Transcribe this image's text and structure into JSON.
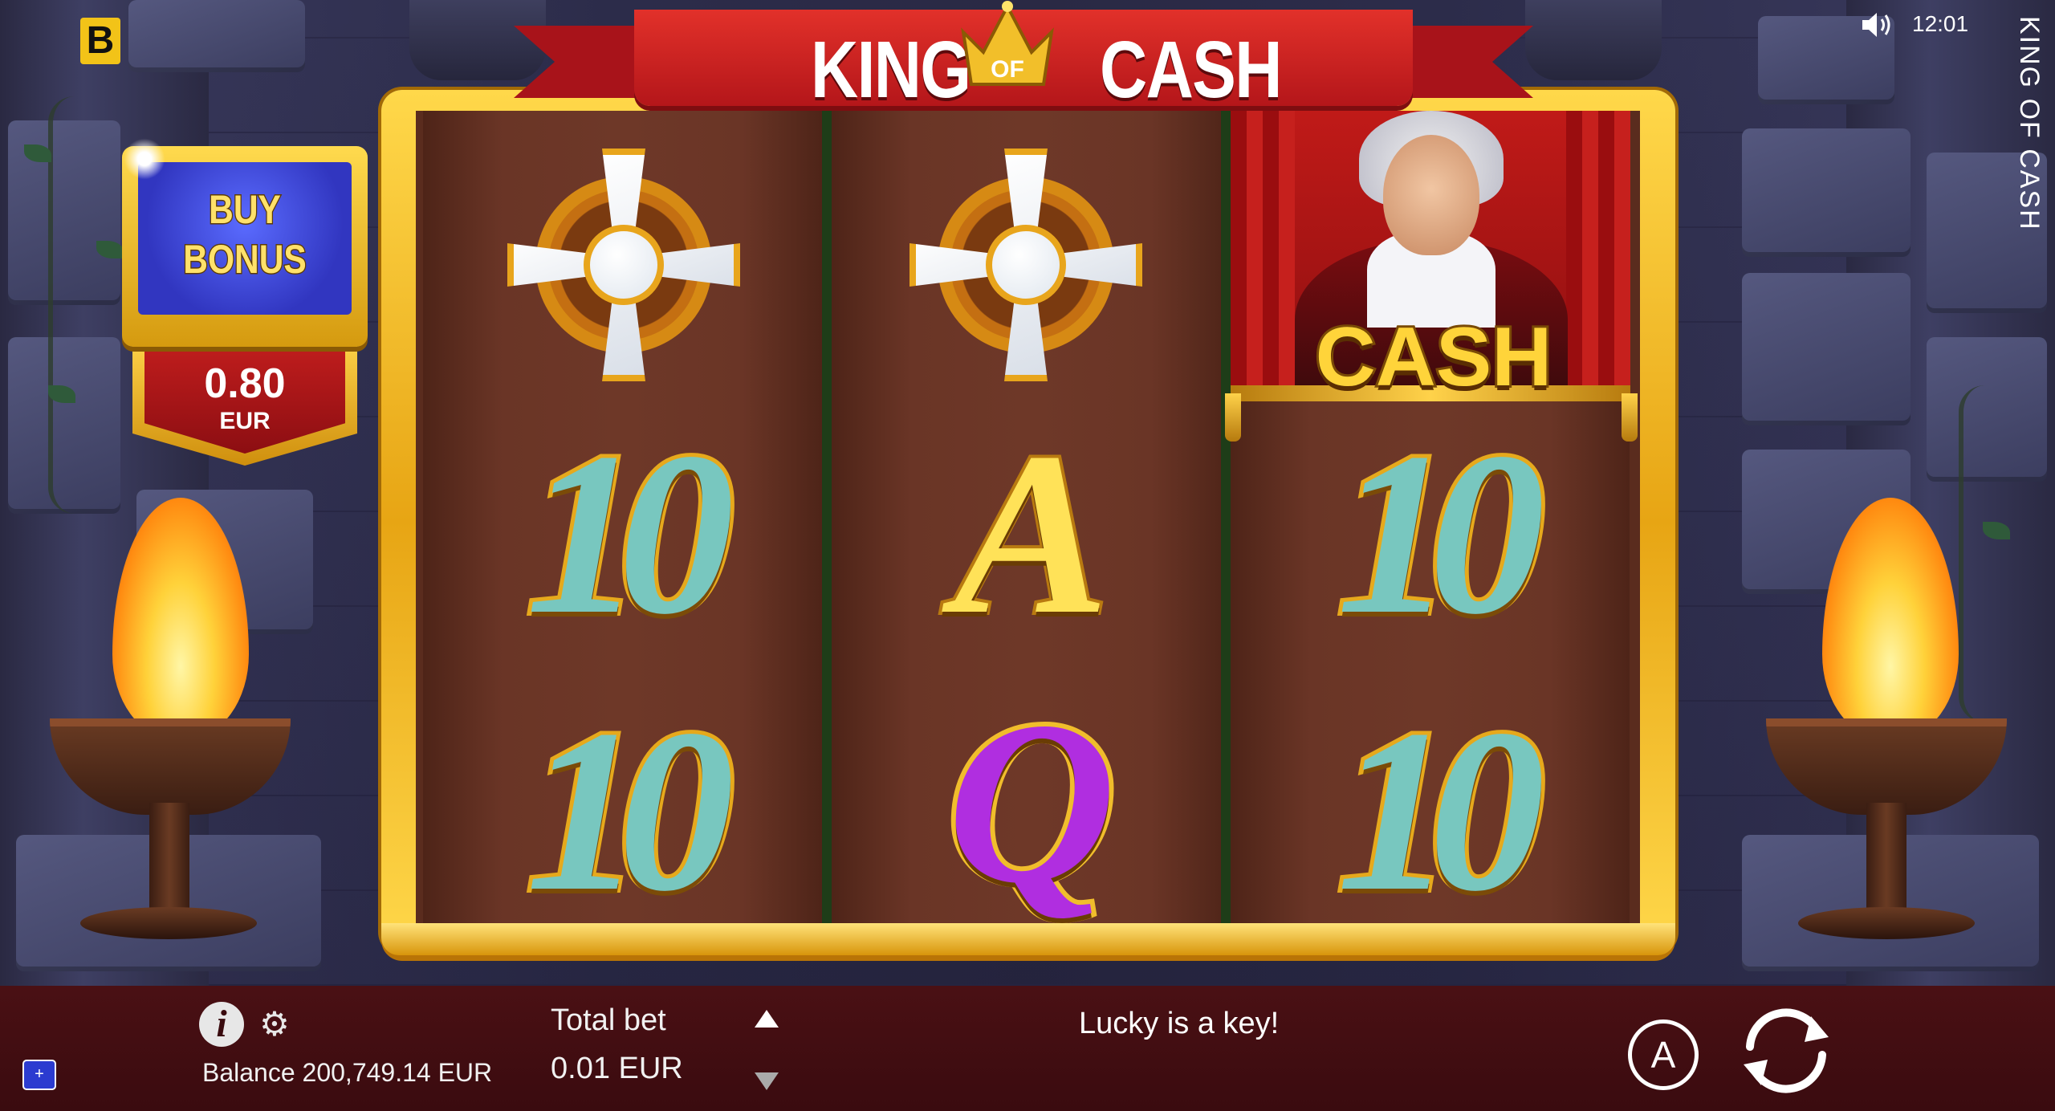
{
  "game": {
    "title_left": "KING",
    "title_of": "OF",
    "title_right": "CASH",
    "vertical_title": "KING OF CASH",
    "logo_letter": "B"
  },
  "status": {
    "time": "12:01"
  },
  "buy_bonus": {
    "label_line1": "BUY",
    "label_line2": "BONUS",
    "price": "0.80",
    "currency": "EUR"
  },
  "reels": [
    {
      "symbols": [
        "order-cross",
        "10",
        "10"
      ]
    },
    {
      "symbols": [
        "order-cross",
        "A",
        "Q"
      ]
    },
    {
      "symbols": [
        "king-cash",
        "10",
        "10"
      ]
    }
  ],
  "cash_symbol_text": "CASH",
  "bottom_bar": {
    "balance": "Balance 200,749.14 EUR",
    "total_bet_label": "Total bet",
    "total_bet_value": "0.01 EUR",
    "message": "Lucky is a key!",
    "auto_label": "A"
  },
  "icons": {
    "sound": "speaker-icon",
    "info": "info-icon",
    "settings": "gear-icon",
    "spin": "spin-icon",
    "autoplay": "autoplay-icon"
  },
  "colors": {
    "frame_gold": "#e7a514",
    "ribbon_red": "#c51f1f",
    "bar_bg": "#3a0b0f",
    "bonus_blue": "#3136c0",
    "ten_teal": "#78c7bf",
    "queen_purple": "#b02ee0"
  }
}
